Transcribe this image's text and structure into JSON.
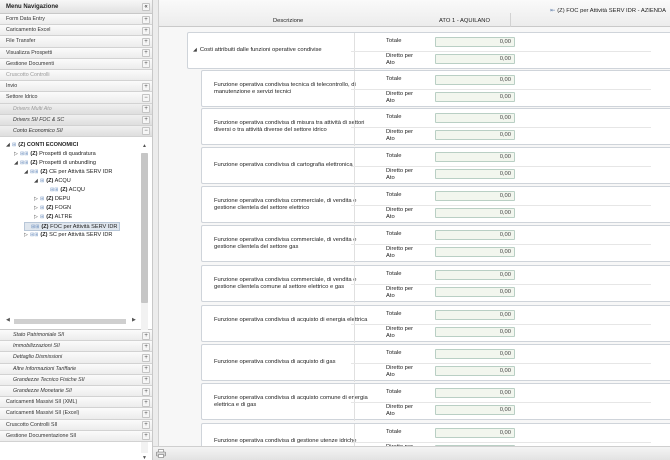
{
  "sidebar": {
    "title": "Menu Navigazione",
    "collapse_icon": "«",
    "top_items": [
      {
        "label": "Form Data Entry",
        "toggle": "+"
      },
      {
        "label": "Caricamento Excel",
        "toggle": "+"
      },
      {
        "label": "File Transfer",
        "toggle": "+"
      },
      {
        "label": "Visualizza Prospetti",
        "toggle": "+"
      },
      {
        "label": "Gestione Documenti",
        "toggle": "+"
      },
      {
        "label": "Cruscotto Controlli",
        "toggle": ""
      },
      {
        "label": "Invio",
        "toggle": "+"
      },
      {
        "label": "Settore Idrico",
        "toggle": "−"
      },
      {
        "label": "Drivers Multi Ato",
        "toggle": "+"
      },
      {
        "label": "Drivers SII FOC & SC",
        "toggle": "+"
      },
      {
        "label": "Conto Economico SII",
        "toggle": "−"
      }
    ],
    "tree": [
      {
        "prefix": "(Z)",
        "label": "CONTI ECONOMICI"
      },
      {
        "prefix": "(Z)",
        "label": "Prospetti di quadratura"
      },
      {
        "prefix": "(Z)",
        "label": "Prospetti di unbundling"
      },
      {
        "prefix": "(Z)",
        "label": "CE per Attività SERV IDR"
      },
      {
        "prefix": "(Z)",
        "label": "ACQU"
      },
      {
        "prefix": "(Z)",
        "label": "ACQU"
      },
      {
        "prefix": "(Z)",
        "label": "DEPU"
      },
      {
        "prefix": "(Z)",
        "label": "FOGN"
      },
      {
        "prefix": "(Z)",
        "label": "ALTRE"
      },
      {
        "prefix": "(Z)",
        "label": "FOC per Attività SERV IDR"
      },
      {
        "prefix": "(Z)",
        "label": "SC per Attività SERV IDR"
      }
    ],
    "bottom_items": [
      {
        "label": "Stato Patrimoniale SII",
        "toggle": "+"
      },
      {
        "label": "Immobilizzazioni SII",
        "toggle": "+"
      },
      {
        "label": "Dettaglio Dismissioni",
        "toggle": "+"
      },
      {
        "label": "Altre Informazioni Tariffarie",
        "toggle": "+"
      },
      {
        "label": "Grandezze Tecnico Fisiche SII",
        "toggle": "+"
      },
      {
        "label": "Grandezze Monetarie SII",
        "toggle": "+"
      },
      {
        "label": "Caricamenti Massivi SII (XML)",
        "toggle": "+"
      },
      {
        "label": "Caricamenti Massivi SII (Excel)",
        "toggle": "+"
      },
      {
        "label": "Cruscotto Controlli SII",
        "toggle": "+"
      },
      {
        "label": "Gestione Documentazione SII",
        "toggle": "+"
      }
    ]
  },
  "main": {
    "tab_title": "(Z) FOC per Attività SERV IDR - AZIENDA",
    "col_descrizione": "Descrizione",
    "col_ato": "ATO 1 - AQUILANO",
    "label_totale": "Totale",
    "label_diretto": "Diretto per Ato",
    "rows": [
      {
        "desc": "Costi attribuiti dalle funzioni operative condivise",
        "totale": "0,00",
        "diretto": "0,00"
      },
      {
        "desc": "Funzione operativa condivisa tecnica di telecontrollo, di manutenzione e servizi tecnici",
        "totale": "0,00",
        "diretto": "0,00"
      },
      {
        "desc": "Funzione operativa condivisa di misura tra attività di settori diversi o tra attività diverse del settore idrico",
        "totale": "0,00",
        "diretto": "0,00"
      },
      {
        "desc": "Funzione operativa condivisa di cartografia elettronica",
        "totale": "0,00",
        "diretto": "0,00"
      },
      {
        "desc": "Funzione operativa condivisa commerciale, di vendita e gestione clientela del settore elettrico",
        "totale": "0,00",
        "diretto": "0,00"
      },
      {
        "desc": "Funzione operativa condivisa commerciale, di vendita e gestione clientela del settore gas",
        "totale": "0,00",
        "diretto": "0,00"
      },
      {
        "desc": "Funzione operativa condivisa commerciale, di vendita e gestione clientela comune al settore elettrico e gas",
        "totale": "0,00",
        "diretto": "0,00"
      },
      {
        "desc": "Funzione operativa condivisa di acquisto di energia elettrica",
        "totale": "0,00",
        "diretto": "0,00"
      },
      {
        "desc": "Funzione operativa condivisa di acquisto di gas",
        "totale": "0,00",
        "diretto": "0,00"
      },
      {
        "desc": "Funzione operativa condivisa di acquisto comune di energia elettrica e di gas",
        "totale": "0,00",
        "diretto": "0,00"
      },
      {
        "desc": "Funzione operativa condivisa di gestione utenze idriche",
        "totale": "0,00",
        "diretto": ""
      }
    ]
  }
}
